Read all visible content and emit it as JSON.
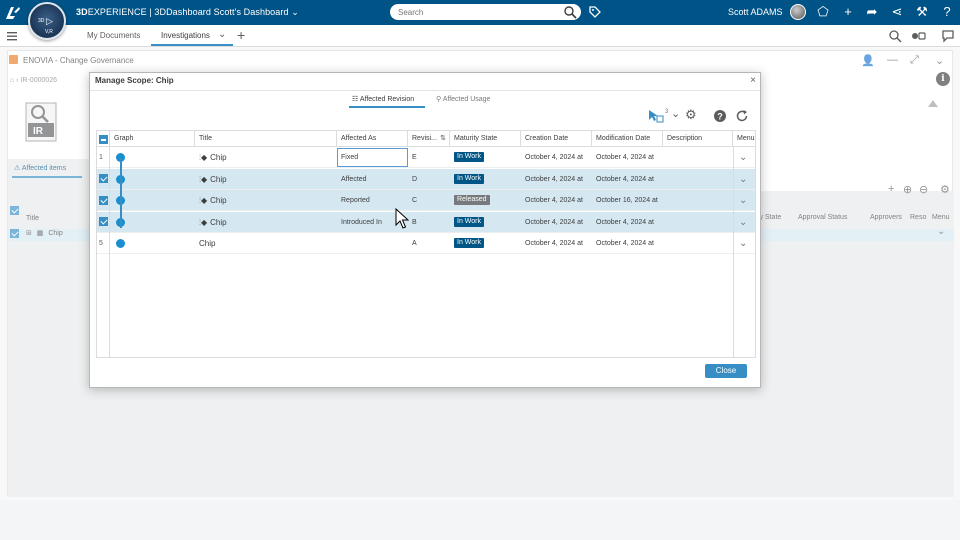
{
  "topbar": {
    "brand_bold": "3D",
    "brand_rest": "EXPERIENCE | 3DDashboard",
    "dashboard_name": "Scott's Dashboard",
    "search_placeholder": "Search",
    "user_name": "Scott ADAMS",
    "compass_top": "3D",
    "compass_bottom": "V,R"
  },
  "tabs": [
    {
      "label": "My Documents",
      "active": false
    },
    {
      "label": "Investigations",
      "active": true
    }
  ],
  "widget": {
    "title": "ENOVIA - Change Governance",
    "breadcrumb": "IR-0000026",
    "ir_label": "IR",
    "left_tab": "Affected items",
    "left_col_title": "Title",
    "left_row_item": "Chip",
    "right_headers": [
      "ity State",
      "Approval Status",
      "Approvers",
      "Reso",
      "Menu"
    ]
  },
  "modal": {
    "title": "Manage Scope: Chip",
    "tabs": [
      {
        "label": "Affected Revision",
        "active": true
      },
      {
        "label": "Affected Usage",
        "active": false
      }
    ],
    "selection_count": "3",
    "columns": [
      "Graph",
      "Title",
      "Affected As",
      "Revisi...",
      "Maturity State",
      "Creation Date",
      "Modification Date",
      "Description",
      "Menu"
    ],
    "rows": [
      {
        "num": "1",
        "checked": false,
        "title": "Chip",
        "has_icon": true,
        "affected_as": "Fixed",
        "revision": "E",
        "state": "In Work",
        "created": "October 4, 2024 at",
        "modified": "October 4, 2024 at"
      },
      {
        "num": "",
        "checked": true,
        "title": "Chip",
        "has_icon": true,
        "affected_as": "Affected",
        "revision": "D",
        "state": "In Work",
        "created": "October 4, 2024 at",
        "modified": "October 4, 2024 at"
      },
      {
        "num": "",
        "checked": true,
        "title": "Chip",
        "has_icon": true,
        "affected_as": "Reported",
        "revision": "C",
        "state": "Released",
        "created": "October 4, 2024 at",
        "modified": "October 16, 2024 at"
      },
      {
        "num": "",
        "checked": true,
        "title": "Chip",
        "has_icon": true,
        "affected_as": "Introduced In",
        "revision": "B",
        "state": "In Work",
        "created": "October 4, 2024 at",
        "modified": "October 4, 2024 at"
      },
      {
        "num": "5",
        "checked": false,
        "title": "Chip",
        "has_icon": false,
        "affected_as": "",
        "revision": "A",
        "state": "In Work",
        "created": "October 4, 2024 at",
        "modified": "October 4, 2024 at"
      }
    ],
    "close_label": "Close"
  },
  "colors": {
    "brand_blue": "#005386",
    "accent_blue": "#368ec4",
    "in_work_badge": "#005686",
    "released_badge": "#77797c",
    "selected_row": "#d5e8f2"
  }
}
